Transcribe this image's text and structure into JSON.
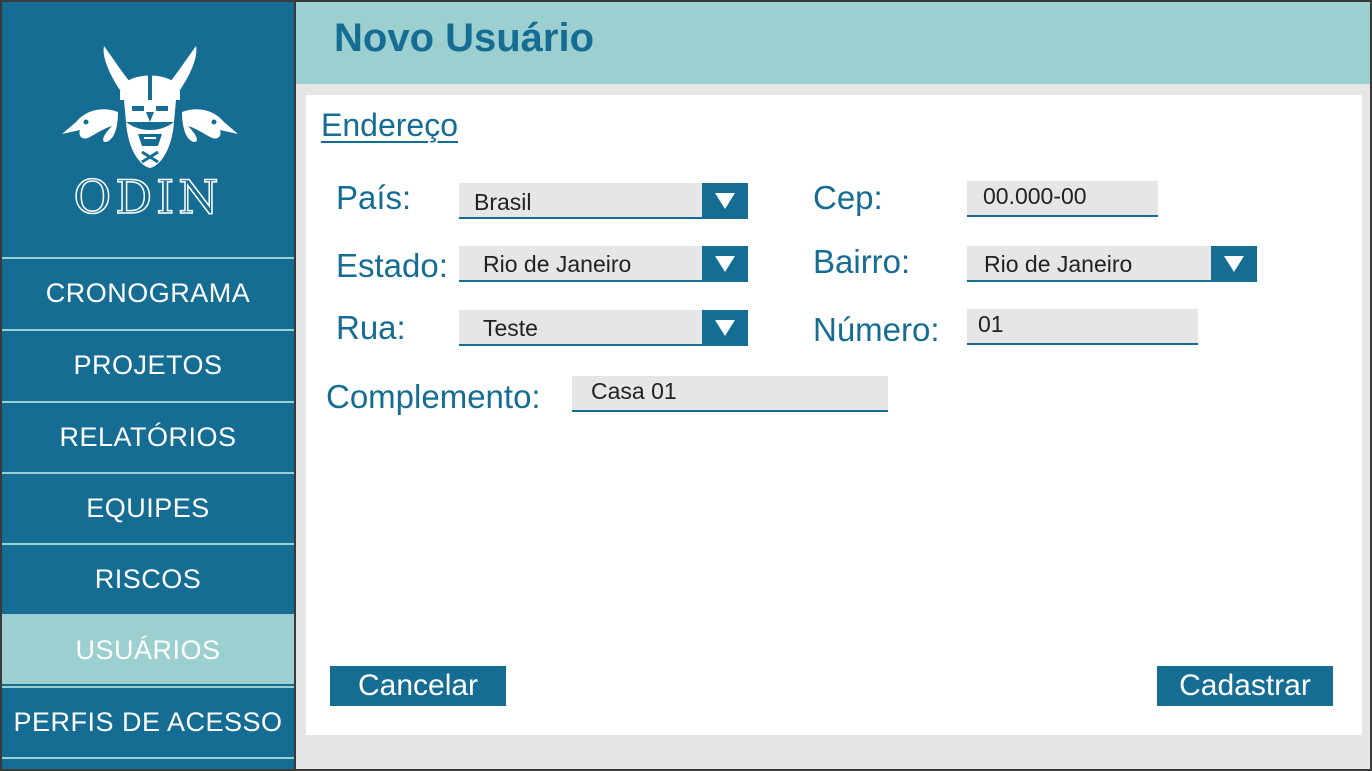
{
  "app": {
    "logo_text": "ODIN",
    "page_title": "Novo Usuário"
  },
  "sidebar": {
    "items": [
      {
        "label": "CRONOGRAMA",
        "active": false
      },
      {
        "label": "PROJETOS",
        "active": false
      },
      {
        "label": "RELATÓRIOS",
        "active": false
      },
      {
        "label": "EQUIPES",
        "active": false
      },
      {
        "label": "RISCOS",
        "active": false
      },
      {
        "label": "USUÁRIOS",
        "active": true
      },
      {
        "label": "PERFIS DE ACESSO",
        "active": false
      }
    ]
  },
  "form": {
    "section_title": "Endereço",
    "pais": {
      "label": "País:",
      "value": "Brasil"
    },
    "estado": {
      "label": "Estado:",
      "value": "Rio de Janeiro"
    },
    "rua": {
      "label": "Rua:",
      "value": "Teste"
    },
    "cep": {
      "label": "Cep:",
      "value": "00.000-00"
    },
    "bairro": {
      "label": "Bairro:",
      "value": "Rio de Janeiro"
    },
    "numero": {
      "label": "Número:",
      "value": "01"
    },
    "complemento": {
      "label": "Complemento:",
      "value": "Casa 01"
    }
  },
  "actions": {
    "cancel_label": "Cancelar",
    "submit_label": "Cadastrar"
  },
  "colors": {
    "primary": "#156d93",
    "accent": "#9ccfcf",
    "background": "#e6e6e6"
  },
  "icons": [
    "odin-logo-icon",
    "dropdown-arrow-icon"
  ]
}
